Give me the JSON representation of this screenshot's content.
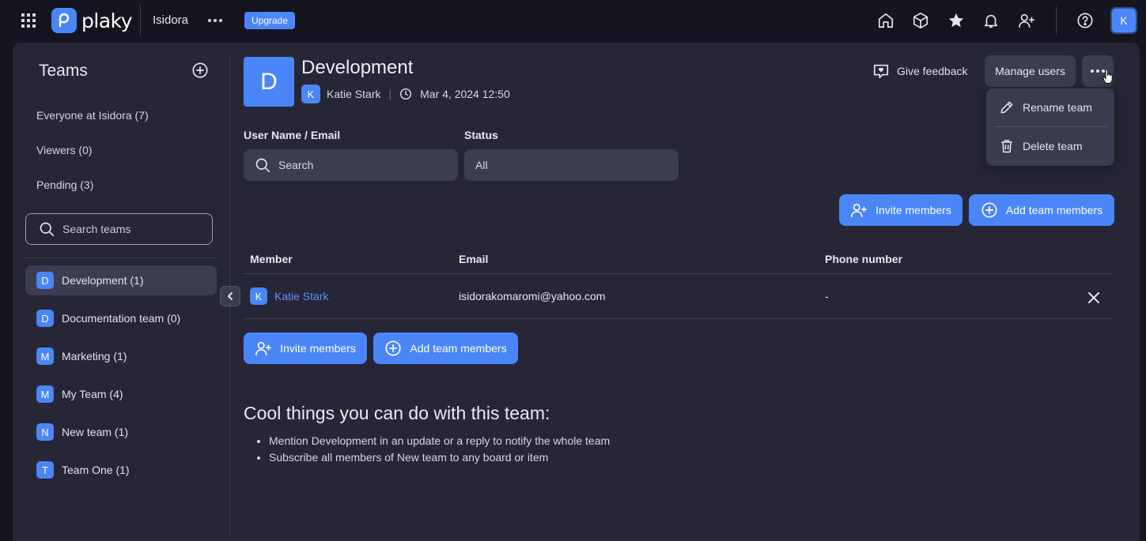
{
  "topbar": {
    "brand": "plaky",
    "workspace": "Isidora",
    "upgrade_label": "Upgrade",
    "avatar_initial": "K",
    "icons": [
      "home-icon",
      "cube-icon",
      "star-icon",
      "bell-icon",
      "add-user-icon",
      "help-icon"
    ]
  },
  "sidebar": {
    "title": "Teams",
    "links": [
      {
        "label": "Everyone at Isidora (7)"
      },
      {
        "label": "Viewers (0)"
      },
      {
        "label": "Pending (3)"
      }
    ],
    "search_placeholder": "Search teams",
    "teams": [
      {
        "initial": "D",
        "label": "Development (1)",
        "active": true
      },
      {
        "initial": "D",
        "label": "Documentation team (0)"
      },
      {
        "initial": "M",
        "label": "Marketing (1)"
      },
      {
        "initial": "M",
        "label": "My Team (4)"
      },
      {
        "initial": "N",
        "label": "New team (1)"
      },
      {
        "initial": "T",
        "label": "Team One (1)"
      }
    ]
  },
  "main": {
    "team_initial": "D",
    "team_name": "Development",
    "owner_initial": "K",
    "owner_name": "Katie Stark",
    "created": "Mar 4, 2024 12:50",
    "feedback_label": "Give feedback",
    "manage_users_label": "Manage users",
    "menu": {
      "rename_label": "Rename team",
      "delete_label": "Delete team"
    },
    "filters": {
      "user_label": "User Name / Email",
      "user_placeholder": "Search",
      "status_label": "Status",
      "status_value": "All"
    },
    "invite_label": "Invite members",
    "add_label": "Add team members",
    "table": {
      "columns": [
        "Member",
        "Email",
        "Phone number"
      ],
      "rows": [
        {
          "initial": "K",
          "member": "Katie Stark",
          "email": "isidorakomaromi@yahoo.com",
          "phone": "-"
        }
      ]
    },
    "cool": {
      "title": "Cool things you can do with this team:",
      "items": [
        "Mention Development in an update or a reply to notify the whole team",
        "Subscribe all members of New team to any board or item"
      ]
    }
  },
  "colors": {
    "accent": "#4a86f7",
    "background": "#15151f",
    "panel": "#262636",
    "field": "#3c3d50",
    "link": "#5b95fb"
  }
}
